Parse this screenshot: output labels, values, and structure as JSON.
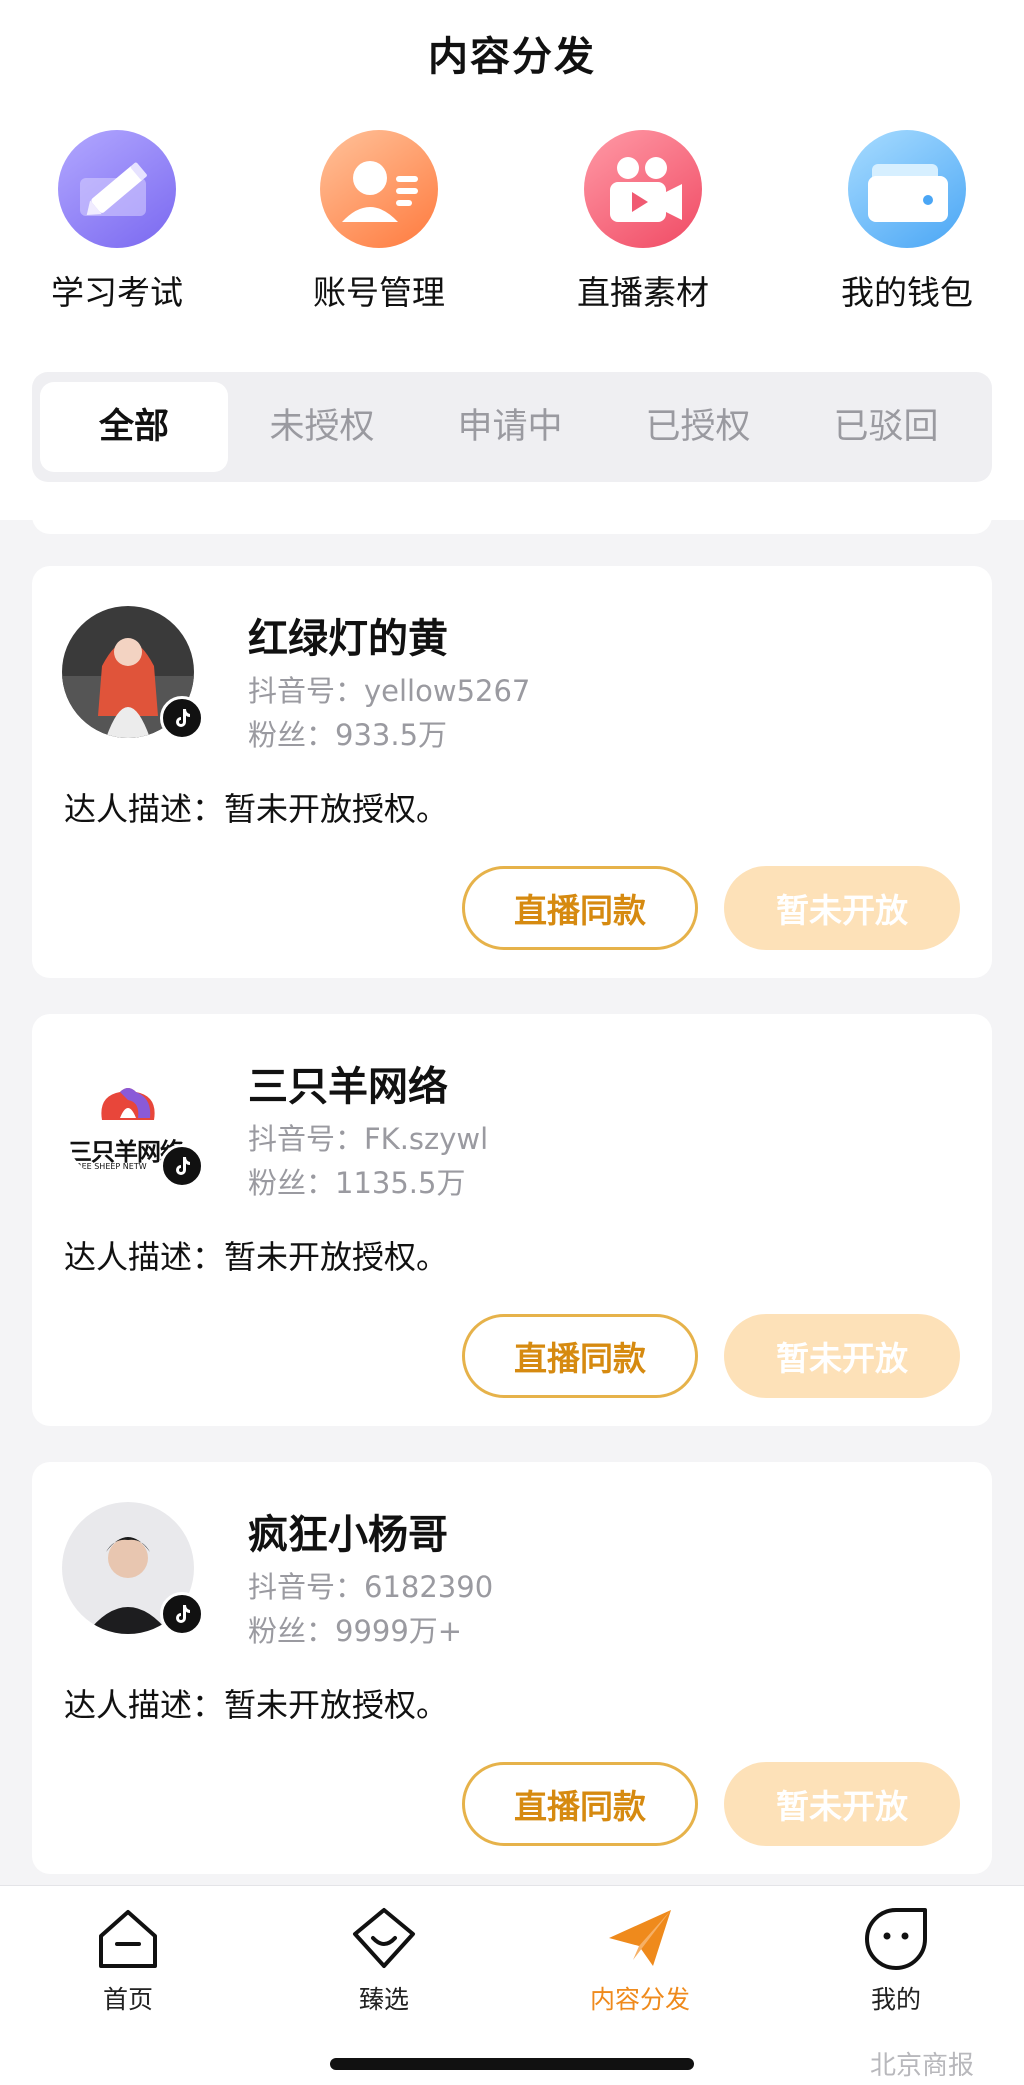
{
  "header": {
    "title": "内容分发"
  },
  "quick_actions": [
    {
      "label": "学习考试",
      "icon": "pencil-icon"
    },
    {
      "label": "账号管理",
      "icon": "account-icon"
    },
    {
      "label": "直播素材",
      "icon": "video-camera-icon"
    },
    {
      "label": "我的钱包",
      "icon": "wallet-icon"
    }
  ],
  "tabs": [
    {
      "label": "全部",
      "active": true
    },
    {
      "label": "未授权",
      "active": false
    },
    {
      "label": "申请中",
      "active": false
    },
    {
      "label": "已授权",
      "active": false
    },
    {
      "label": "已驳回",
      "active": false
    }
  ],
  "cards": [
    {
      "name": "红绿灯的黄",
      "douyin_id": "抖音号：yellow5267",
      "fans": "粉丝：933.5万",
      "desc": "达人描述：暂未开放授权。",
      "btn_live": "直播同款",
      "btn_closed": "暂未开放"
    },
    {
      "name": "三只羊网络",
      "douyin_id": "抖音号：FK.szywl",
      "fans": "粉丝：1135.5万",
      "desc": "达人描述：暂未开放授权。",
      "btn_live": "直播同款",
      "btn_closed": "暂未开放",
      "logo_text": "三只羊网络",
      "logo_sub": "HREE SHEEP NETW"
    },
    {
      "name": "疯狂小杨哥",
      "douyin_id": "抖音号：6182390",
      "fans": "粉丝：9999万+",
      "desc": "达人描述：暂未开放授权。",
      "btn_live": "直播同款",
      "btn_closed": "暂未开放"
    }
  ],
  "bottom_nav": [
    {
      "label": "首页",
      "icon": "home-icon",
      "active": false
    },
    {
      "label": "臻选",
      "icon": "select-icon",
      "active": false
    },
    {
      "label": "内容分发",
      "icon": "paper-plane-icon",
      "active": true
    },
    {
      "label": "我的",
      "icon": "profile-face-icon",
      "active": false
    }
  ],
  "watermark": "北京商报",
  "colors": {
    "accent": "#ef8a1c",
    "button_border": "#e6b24a",
    "button_disabled": "#fde1b8"
  }
}
